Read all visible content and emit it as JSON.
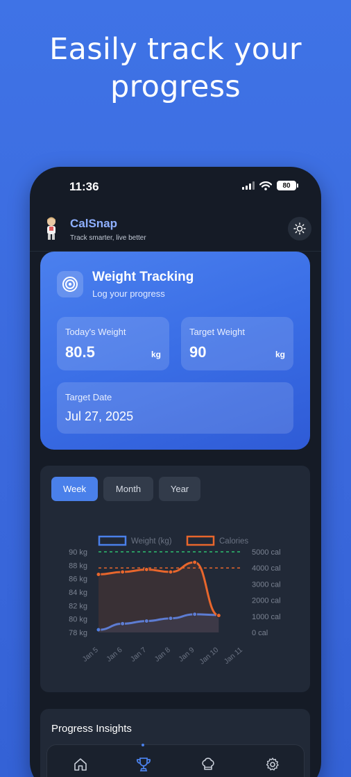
{
  "headline": {
    "line1": "Easily track your",
    "line2": "progress"
  },
  "status_bar": {
    "time": "11:36",
    "battery": "80"
  },
  "app": {
    "name": "CalSnap",
    "tagline": "Track smarter, live better"
  },
  "weight_card": {
    "title": "Weight Tracking",
    "subtitle": "Log your progress",
    "today": {
      "label": "Today's Weight",
      "value": "80.5",
      "unit": "kg"
    },
    "target": {
      "label": "Target Weight",
      "value": "90",
      "unit": "kg"
    },
    "target_date": {
      "label": "Target Date",
      "value": "Jul 27, 2025"
    }
  },
  "tabs": [
    {
      "label": "Week",
      "active": true
    },
    {
      "label": "Month",
      "active": false
    },
    {
      "label": "Year",
      "active": false
    }
  ],
  "chart_data": {
    "type": "line",
    "categories": [
      "Jan 5",
      "Jan 6",
      "Jan 7",
      "Jan 8",
      "Jan 9",
      "Jan 10",
      "Jan 11"
    ],
    "series": [
      {
        "name": "Weight (kg)",
        "axis": "left",
        "color": "#4a80ea",
        "values": [
          78.4,
          79.3,
          79.7,
          80.1,
          80.7,
          80.6,
          null
        ]
      },
      {
        "name": "Calories",
        "axis": "right",
        "color": "#e8662c",
        "values": [
          3600,
          3750,
          3900,
          3750,
          4350,
          1050,
          null
        ]
      }
    ],
    "reference_lines": [
      {
        "axis": "left",
        "value": 90,
        "color": "#2fbf71"
      },
      {
        "axis": "right",
        "value": 4000,
        "color": "#e8662c"
      }
    ],
    "left_axis": {
      "ylim": [
        78,
        90
      ],
      "ticks": [
        78,
        80,
        82,
        84,
        86,
        88,
        90
      ],
      "tick_labels": [
        "78 kg",
        "80 kg",
        "82 kg",
        "84 kg",
        "86 kg",
        "88 kg",
        "90 kg"
      ]
    },
    "right_axis": {
      "ylim": [
        0,
        5000
      ],
      "ticks": [
        0,
        1000,
        2000,
        3000,
        4000,
        5000
      ],
      "tick_labels": [
        "0 cal",
        "1000 cal",
        "2000 cal",
        "3000 cal",
        "4000 cal",
        "5000 cal"
      ]
    },
    "legend": "top",
    "grid": false
  },
  "insights": {
    "title": "Progress Insights"
  },
  "nav": [
    {
      "icon": "home-icon",
      "active": false
    },
    {
      "icon": "trophy-icon",
      "active": true
    },
    {
      "icon": "chef-hat-icon",
      "active": false
    },
    {
      "icon": "gear-icon",
      "active": false
    }
  ]
}
